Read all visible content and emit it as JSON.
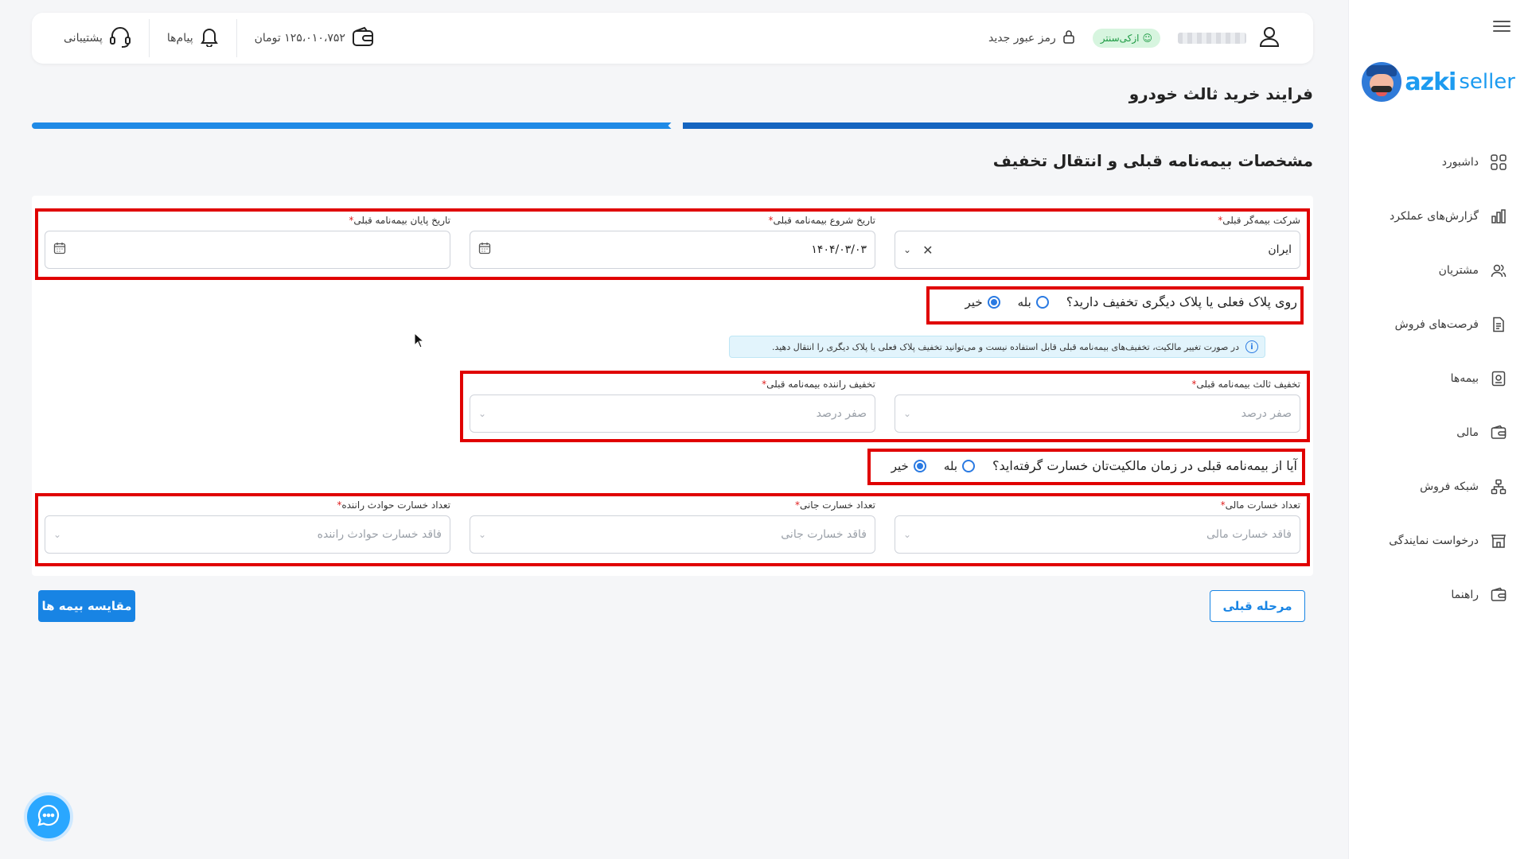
{
  "sidebar": {
    "brand_a": "azki",
    "brand_b": "seller",
    "items": [
      {
        "label": "داشبورد",
        "icon": "dashboard-icon"
      },
      {
        "label": "گزارش‌های عملکرد",
        "icon": "chart-icon"
      },
      {
        "label": "مشتریان",
        "icon": "users-icon"
      },
      {
        "label": "فرصت‌های فروش",
        "icon": "document-icon"
      },
      {
        "label": "بیمه‌ها",
        "icon": "policy-icon"
      },
      {
        "label": "مالی",
        "icon": "wallet-icon"
      },
      {
        "label": "شبکه فروش",
        "icon": "network-icon"
      },
      {
        "label": "درخواست نمایندگی",
        "icon": "store-icon"
      },
      {
        "label": "راهنما",
        "icon": "guide-icon"
      }
    ]
  },
  "header": {
    "badge": "ازکی‌سنتر",
    "new_password": "رمز عبور جدید",
    "balance": "۱۲۵،۰۱۰،۷۵۲ تومان",
    "messages": "پیام‌ها",
    "support": "پشتیبانی"
  },
  "page": {
    "title": "فرایند خرید ثالث خودرو",
    "section_title": "مشخصات بیمه‌نامه قبلی و انتقال تخفیف",
    "progress_fraction": 0.5
  },
  "form": {
    "prev_insurer_label": "شرکت بیمه‌گر قبلی",
    "prev_insurer_value": "ایران",
    "start_date_label": "تاریخ شروع بیمه‌نامه قبلی",
    "start_date_value": "۱۴۰۴/۰۳/۰۳",
    "end_date_label": "تاریخ پایان بیمه‌نامه قبلی",
    "end_date_value": "",
    "plate_discount_q": "روی پلاک فعلی یا پلاک دیگری تخفیف دارید؟",
    "yes": "بله",
    "no": "خیر",
    "info_text": "در صورت تغییر مالکیت، تخفیف‌های بیمه‌نامه قبلی قابل استفاده نیست و می‌توانید تخفیف پلاک فعلی یا پلاک دیگری را انتقال دهید.",
    "third_discount_label": "تخفیف ثالث بیمه‌نامه قبلی",
    "third_discount_ph": "صفر درصد",
    "driver_discount_label": "تخفیف راننده بیمه‌نامه قبلی",
    "driver_discount_ph": "صفر درصد",
    "damage_q": "آیا از بیمه‌نامه قبلی در زمان مالکیت‌تان خسارت گرفته‌اید؟",
    "financial_label": "تعداد خسارت مالی",
    "financial_ph": "فاقد خسارت مالی",
    "bodily_label": "تعداد خسارت جانی",
    "bodily_ph": "فاقد خسارت جانی",
    "driver_accident_label": "تعداد خسارت حوادث راننده",
    "driver_accident_ph": "فاقد خسارت حوادث راننده"
  },
  "actions": {
    "compare": "مقایسه بیمه ها",
    "previous": "مرحله قبلی"
  },
  "colors": {
    "accent": "#1884e4",
    "highlight": "#e00000",
    "badge_bg": "#d7f5df"
  }
}
